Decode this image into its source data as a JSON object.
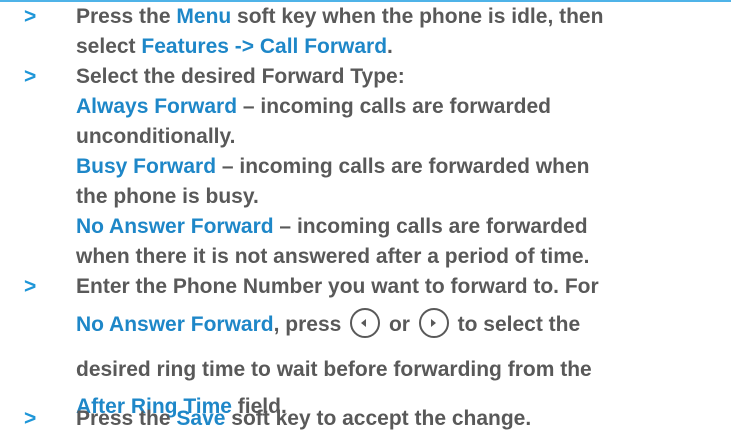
{
  "steps": [
    {
      "bullet": ">",
      "line1": {
        "a": "Press the ",
        "b": "Menu",
        "c": " soft key when the phone is idle, then"
      },
      "line2": {
        "a": "select ",
        "b": "Features -> Call Forward",
        "c": "."
      }
    },
    {
      "bullet": ">",
      "intro": "Select the desired Forward Type:",
      "options": [
        {
          "name": "Always Forward",
          "desc1": " – incoming calls are forwarded",
          "desc2": "unconditionally."
        },
        {
          "name": "Busy Forward",
          "desc1": " – incoming calls are forwarded when",
          "desc2": "the phone is busy."
        },
        {
          "name": "No Answer Forward",
          "desc1": " – incoming calls are forwarded",
          "desc2": "when there it is not answered after a period of time."
        }
      ]
    },
    {
      "bullet": ">",
      "line1": "Enter the Phone Number you want to forward to. For",
      "line2": {
        "a": "No Answer Forward",
        "b": ", press ",
        "c": " or ",
        "d": " to select the"
      },
      "line3": "desired ring time to wait before forwarding from the",
      "line4": {
        "a": "After Ring Time",
        "b": " field."
      },
      "icons": [
        "left-arrow-button-icon",
        "right-arrow-button-icon"
      ]
    },
    {
      "bullet": ">",
      "line1": {
        "a": "Press the ",
        "b": "Save",
        "c": " soft key to accept the change."
      }
    }
  ],
  "colors": {
    "accent": "#1e87c8",
    "text": "#595959",
    "rule": "#4fb3e8"
  }
}
